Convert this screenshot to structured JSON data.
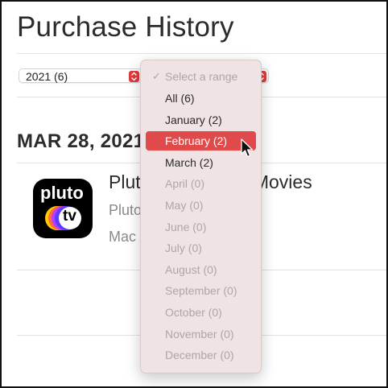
{
  "page": {
    "title": "Purchase History"
  },
  "filters": {
    "year_select_value": "2021 (6)"
  },
  "purchase_group": {
    "date_heading": "MAR 28, 2021",
    "item": {
      "app_name": "Pluto TV: TV and Movies",
      "publisher": "Pluto Inc.",
      "platform": "Mac",
      "icon_wordmark_top": "pluto",
      "icon_wordmark_bottom": "tv"
    }
  },
  "range_menu": {
    "header": "Select a range",
    "items": [
      {
        "label": "All (6)",
        "enabled": true,
        "selected": false
      },
      {
        "label": "January (2)",
        "enabled": true,
        "selected": false
      },
      {
        "label": "February (2)",
        "enabled": true,
        "selected": true
      },
      {
        "label": "March (2)",
        "enabled": true,
        "selected": false
      },
      {
        "label": "April (0)",
        "enabled": false,
        "selected": false
      },
      {
        "label": "May (0)",
        "enabled": false,
        "selected": false
      },
      {
        "label": "June (0)",
        "enabled": false,
        "selected": false
      },
      {
        "label": "July (0)",
        "enabled": false,
        "selected": false
      },
      {
        "label": "August (0)",
        "enabled": false,
        "selected": false
      },
      {
        "label": "September (0)",
        "enabled": false,
        "selected": false
      },
      {
        "label": "October (0)",
        "enabled": false,
        "selected": false
      },
      {
        "label": "November (0)",
        "enabled": false,
        "selected": false
      },
      {
        "label": "December (0)",
        "enabled": false,
        "selected": false
      }
    ]
  },
  "colors": {
    "accent": "#e14a4a",
    "menu_background": "#efe3e3"
  }
}
